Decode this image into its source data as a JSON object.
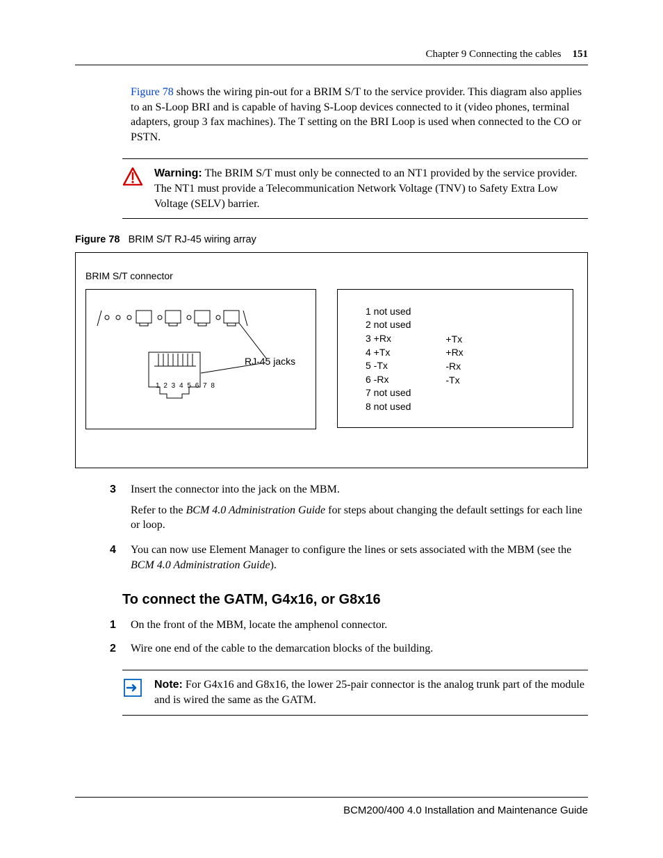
{
  "header": {
    "chapter": "Chapter 9  Connecting the cables",
    "page_number": "151"
  },
  "intro": {
    "figref": "Figure 78",
    "rest": " shows the wiring pin-out for a BRIM S/T to the service provider. This diagram also applies to an S-Loop BRI and is capable of having S-Loop devices connected to it (video phones, terminal adapters, group 3 fax machines). The T setting on the BRI Loop is used when connected to the CO or PSTN."
  },
  "warning": {
    "label": "Warning:",
    "text": " The BRIM S/T must only be connected to an NT1 provided by the service provider. The NT1 must provide a Telecommunication Network Voltage (TNV) to Safety Extra Low Voltage (SELV) barrier."
  },
  "figure": {
    "label": "Figure 78",
    "caption": "BRIM S/T RJ-45 wiring array",
    "diagram_title": "BRIM S/T connector",
    "rj_label": "RJ-45 jacks",
    "pins": "1 2 3 4 5 6 7 8",
    "left_col": [
      "1 not used",
      "2 not used",
      "3 +Rx",
      "4 +Tx",
      "5 -Tx",
      "6 -Rx",
      "7 not used",
      "8 not used"
    ],
    "right_col": [
      "+Tx",
      "+Rx",
      "-Rx",
      "-Tx"
    ]
  },
  "steps_a": {
    "s3_p1": "Insert the connector into the jack on the MBM.",
    "s3_p2a": "Refer to the ",
    "s3_p2i": "BCM 4.0 Administration Guide",
    "s3_p2b": " for steps about changing the default settings for each line or loop.",
    "s4_a": "You can now use Element Manager to configure the lines or sets associated with the MBM (see the ",
    "s4_i": "BCM 4.0 Administration Guide",
    "s4_b": ")."
  },
  "section_heading": "To connect the GATM, G4x16, or G8x16",
  "steps_b": {
    "s1": "On the front of the MBM, locate the amphenol connector.",
    "s2": "Wire one end of the cable to the demarcation blocks of the building."
  },
  "note": {
    "label": "Note:",
    "text": " For G4x16 and G8x16, the lower 25-pair connector is the analog trunk part of the module and is wired the same as the GATM."
  },
  "footer": "BCM200/400 4.0 Installation and Maintenance Guide"
}
